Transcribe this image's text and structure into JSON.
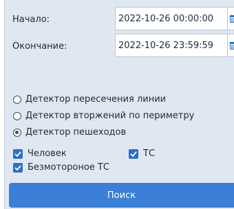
{
  "dates": {
    "start_label": "Начало:",
    "start_value": "2022-10-26 00:00:00",
    "end_label": "Окончание:",
    "end_value": "2022-10-26 23:59:59"
  },
  "detectors": [
    {
      "label": "Детектор пересечения линии",
      "checked": false
    },
    {
      "label": "Детектор вторжений по периметру",
      "checked": false
    },
    {
      "label": "Детектор пешеходов",
      "checked": true
    }
  ],
  "filters": [
    {
      "label": "Человек",
      "checked": true
    },
    {
      "label": "ТС",
      "checked": true
    },
    {
      "label": "Безмотороное ТС",
      "checked": true
    }
  ],
  "search_label": "Поиск",
  "colors": {
    "accent": "#3b7fd6",
    "panel": "#dfe8f1",
    "checkbox": "#2d6fc7"
  }
}
